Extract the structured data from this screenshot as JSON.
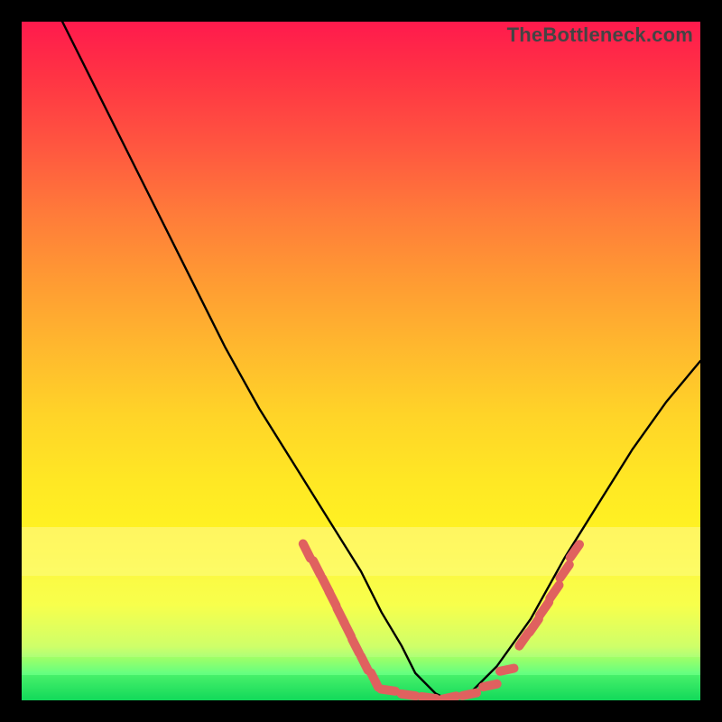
{
  "watermark": "TheBottleneck.com",
  "chart_data": {
    "type": "line",
    "title": "",
    "xlabel": "",
    "ylabel": "",
    "xlim": [
      0,
      100
    ],
    "ylim": [
      0,
      100
    ],
    "grid": false,
    "legend": false,
    "series": [
      {
        "name": "curve",
        "x": [
          6,
          10,
          15,
          20,
          25,
          30,
          35,
          40,
          45,
          50,
          53,
          56,
          58,
          61,
          63,
          66,
          70,
          75,
          80,
          85,
          90,
          95,
          100
        ],
        "y": [
          100,
          92,
          82,
          72,
          62,
          52,
          43,
          35,
          27,
          19,
          13,
          8,
          4,
          1,
          0,
          1,
          5,
          12,
          21,
          29,
          37,
          44,
          50
        ]
      }
    ],
    "annotations": {
      "dash_color": "#e0615f",
      "dashes_left": [
        [
          42,
          22
        ],
        [
          43.5,
          19.5
        ],
        [
          44.8,
          17
        ],
        [
          45.8,
          15
        ],
        [
          47,
          12.5
        ],
        [
          48,
          10.5
        ],
        [
          49.2,
          8
        ],
        [
          50.5,
          5.5
        ],
        [
          52,
          3
        ]
      ],
      "dashes_right": [
        [
          74,
          9
        ],
        [
          75.5,
          11
        ],
        [
          77,
          13.5
        ],
        [
          78.5,
          16
        ],
        [
          80,
          19
        ],
        [
          81.5,
          22
        ]
      ],
      "dashes_bottom": [
        [
          54,
          1.5
        ],
        [
          57,
          0.8
        ],
        [
          60,
          0.4
        ],
        [
          63,
          0.4
        ],
        [
          66,
          0.9
        ],
        [
          69,
          2.2
        ],
        [
          71.5,
          4.5
        ]
      ]
    }
  }
}
